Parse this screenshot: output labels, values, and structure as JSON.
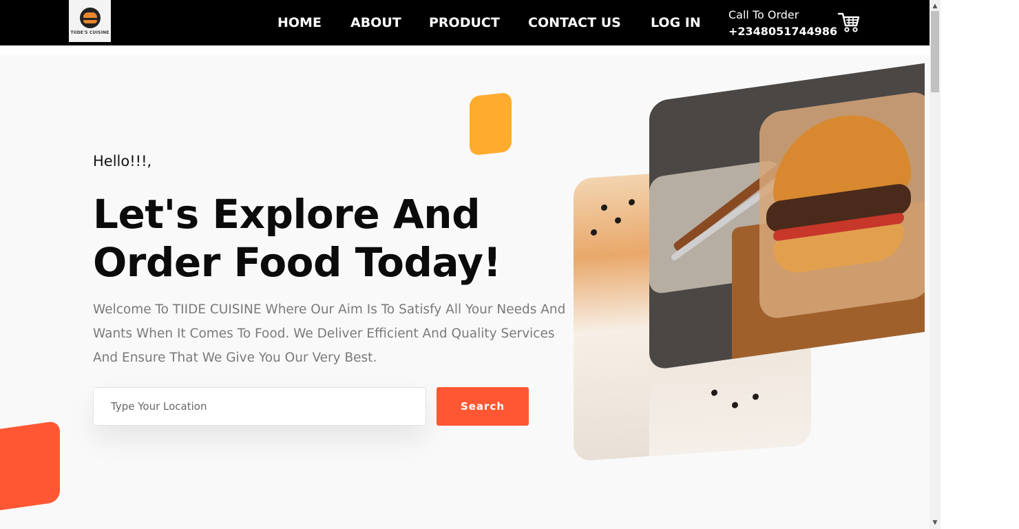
{
  "header": {
    "logo_text": "TIIDE'S CUISINE",
    "nav": [
      {
        "label": "HOME"
      },
      {
        "label": "ABOUT"
      },
      {
        "label": "PRODUCT"
      },
      {
        "label": "CONTACT US"
      },
      {
        "label": "LOG IN"
      }
    ],
    "call_label": "Call To Order",
    "phone": "+2348051744986",
    "cart_icon": "shopping-cart-icon"
  },
  "hero": {
    "greeting": "Hello!!!,",
    "headline_line1": "Let's Explore And",
    "headline_line2": "Order Food Today!",
    "description": "Welcome To TIIDE CUISINE Where Our Aim Is To Satisfy All Your Needs And Wants When It Comes To Food. We Deliver Efficient And Quality Services And Ensure That We Give You Our Very Best.",
    "search": {
      "placeholder": "Type Your Location",
      "value": "",
      "button_label": "Search"
    }
  },
  "colors": {
    "accent": "#ff5733",
    "secondary_accent": "#ffab2e",
    "nav_background": "#000000",
    "hero_background": "#f9f9f9"
  }
}
